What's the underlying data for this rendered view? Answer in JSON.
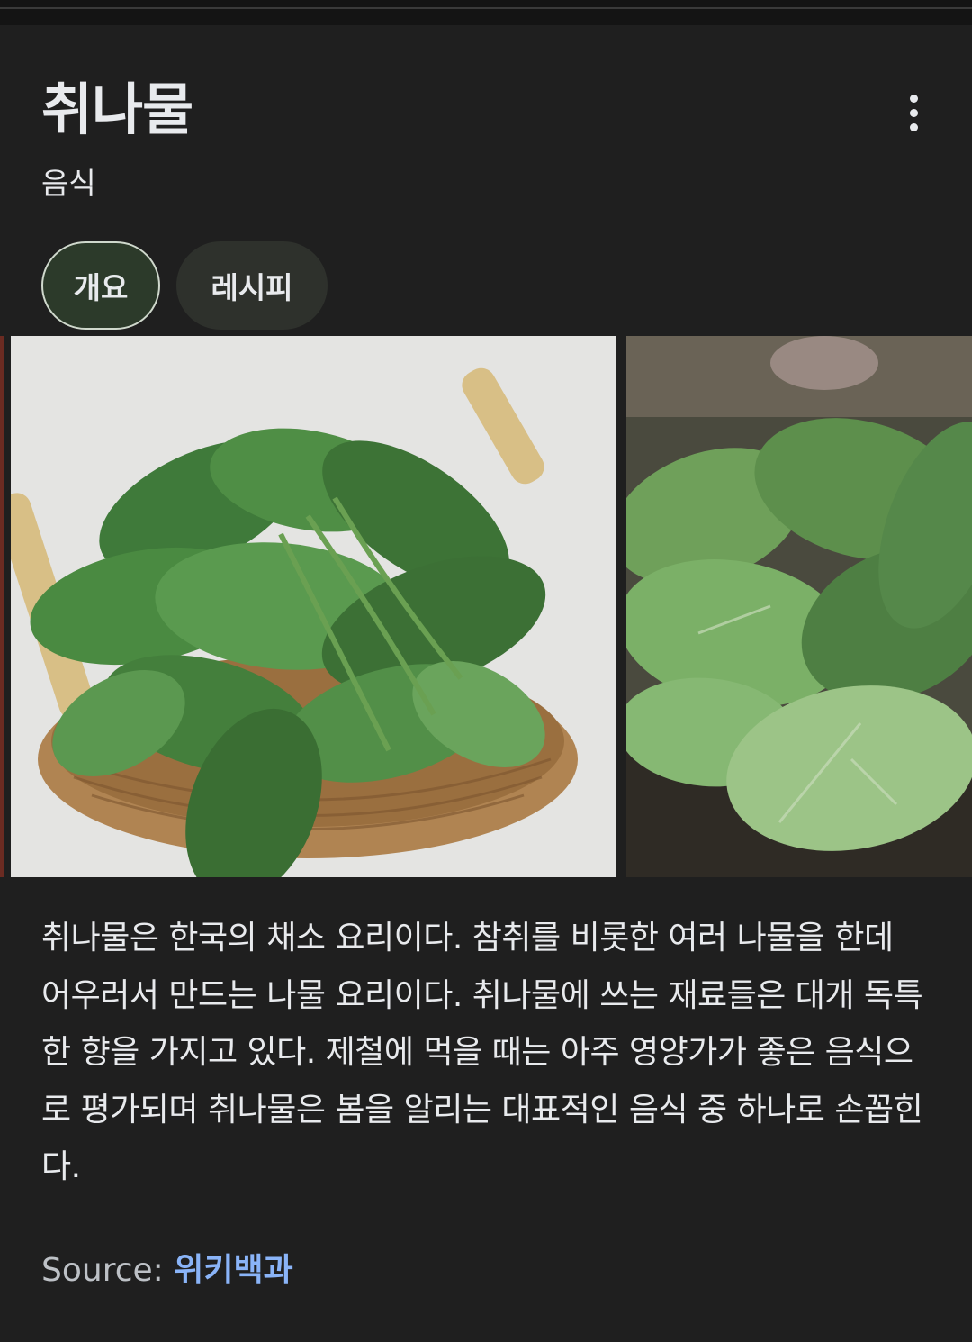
{
  "header": {
    "title": "취나물",
    "subtitle": "음식"
  },
  "more_menu": {
    "icon": "more-vert-icon"
  },
  "tabs": [
    {
      "label": "개요",
      "selected": true
    },
    {
      "label": "레시피",
      "selected": false
    }
  ],
  "images": [
    {
      "alt_icon": "greens-in-basket-image"
    },
    {
      "alt_icon": "greens-growing-image"
    }
  ],
  "description": "취나물은 한국의 채소 요리이다. 참취를 비롯한 여러 나물을 한데 어우러서 만드는 나물 요리이다. 취나물에 쓰는 재료들은 대개 독특한 향을 가지고 있다. 제철에 먹을 때는 아주 영양가가 좋은 음식으로 평가되며 취나물은 봄을 알리는 대표적인 음식 중 하나로 손꼽힌다.",
  "source": {
    "label": "Source:",
    "link_text": "위키백과"
  },
  "colors": {
    "background": "#1f1f1f",
    "text": "#e8eaed",
    "link": "#8ab4f8",
    "chip_selected_bg": "#2c3a2a",
    "chip_bg": "#2e312c"
  }
}
